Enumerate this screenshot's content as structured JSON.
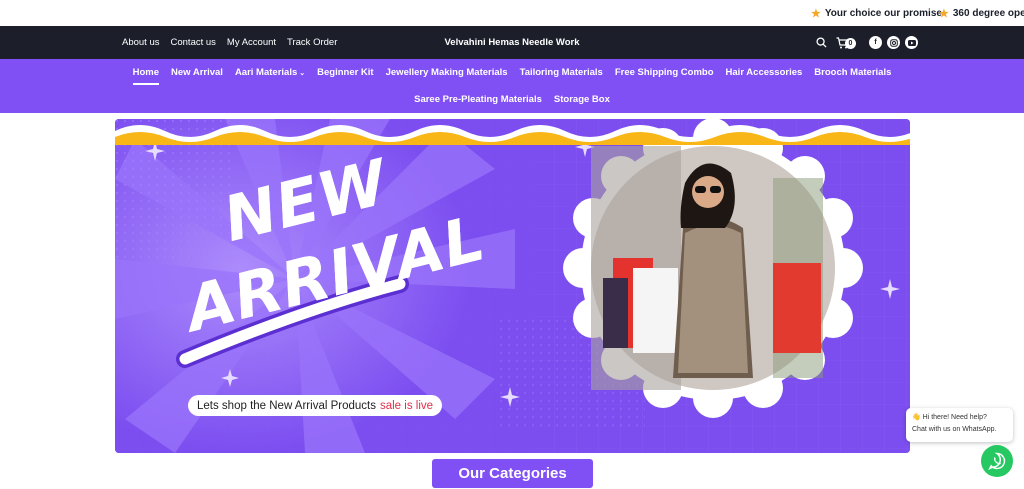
{
  "announcements": [
    {
      "text": "Your choice our promise"
    },
    {
      "text": "360 degree oper"
    }
  ],
  "topbar": {
    "links": [
      "About us",
      "Contact us",
      "My Account",
      "Track Order"
    ],
    "brand": "Velvahini Hemas Needle Work",
    "cart_count": "0",
    "social": [
      "facebook-icon",
      "instagram-icon",
      "youtube-icon"
    ]
  },
  "nav": {
    "row1": [
      "Home",
      "New Arrival",
      "Aari Materials",
      "Beginner Kit",
      "Jewellery Making Materials",
      "Tailoring Materials",
      "Free Shipping Combo",
      "Hair Accessories",
      "Brooch Materials"
    ],
    "row2": [
      "Saree Pre-Pleating Materials",
      "Storage Box"
    ],
    "active": "Home"
  },
  "banner": {
    "headline_1": "NEW",
    "headline_2": "ARRIVAL",
    "tagline": "Lets shop the New Arrival Products",
    "tagline_highlight": "sale is live"
  },
  "categories_button": "Our Categories",
  "whatsapp": {
    "line1": "👋 Hi there! Need help?",
    "line2": "Chat with us on WhatsApp."
  },
  "colors": {
    "brand_purple": "#8050f5",
    "header_dark": "#1c1f2a",
    "whatsapp_green": "#25c861",
    "sale_red": "#e0304a",
    "wave_yellow": "#f8b617"
  }
}
